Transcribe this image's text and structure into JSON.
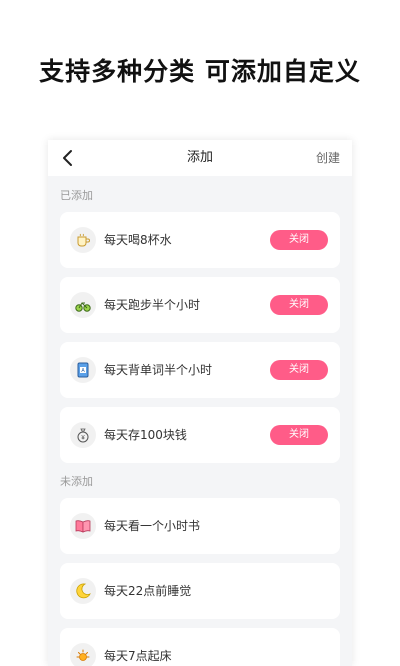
{
  "headline": "支持多种分类 可添加自定义",
  "nav": {
    "title": "添加",
    "create_label": "创建"
  },
  "sections": {
    "added_label": "已添加",
    "not_added_label": "未添加"
  },
  "colors": {
    "accent": "#ff5c88",
    "background": "#f4f5f7"
  },
  "added_items": [
    {
      "label": "每天喝8杯水",
      "icon": "cup-icon",
      "button": "关闭"
    },
    {
      "label": "每天跑步半个小时",
      "icon": "bicycle-icon",
      "button": "关闭"
    },
    {
      "label": "每天背单词半个小时",
      "icon": "vocabulary-book-icon",
      "button": "关闭"
    },
    {
      "label": "每天存100块钱",
      "icon": "money-bag-icon",
      "button": "关闭"
    }
  ],
  "not_added_items": [
    {
      "label": "每天看一个小时书",
      "icon": "open-book-icon"
    },
    {
      "label": "每天22点前睡觉",
      "icon": "moon-icon"
    },
    {
      "label": "每天7点起床",
      "icon": "sun-icon"
    }
  ]
}
